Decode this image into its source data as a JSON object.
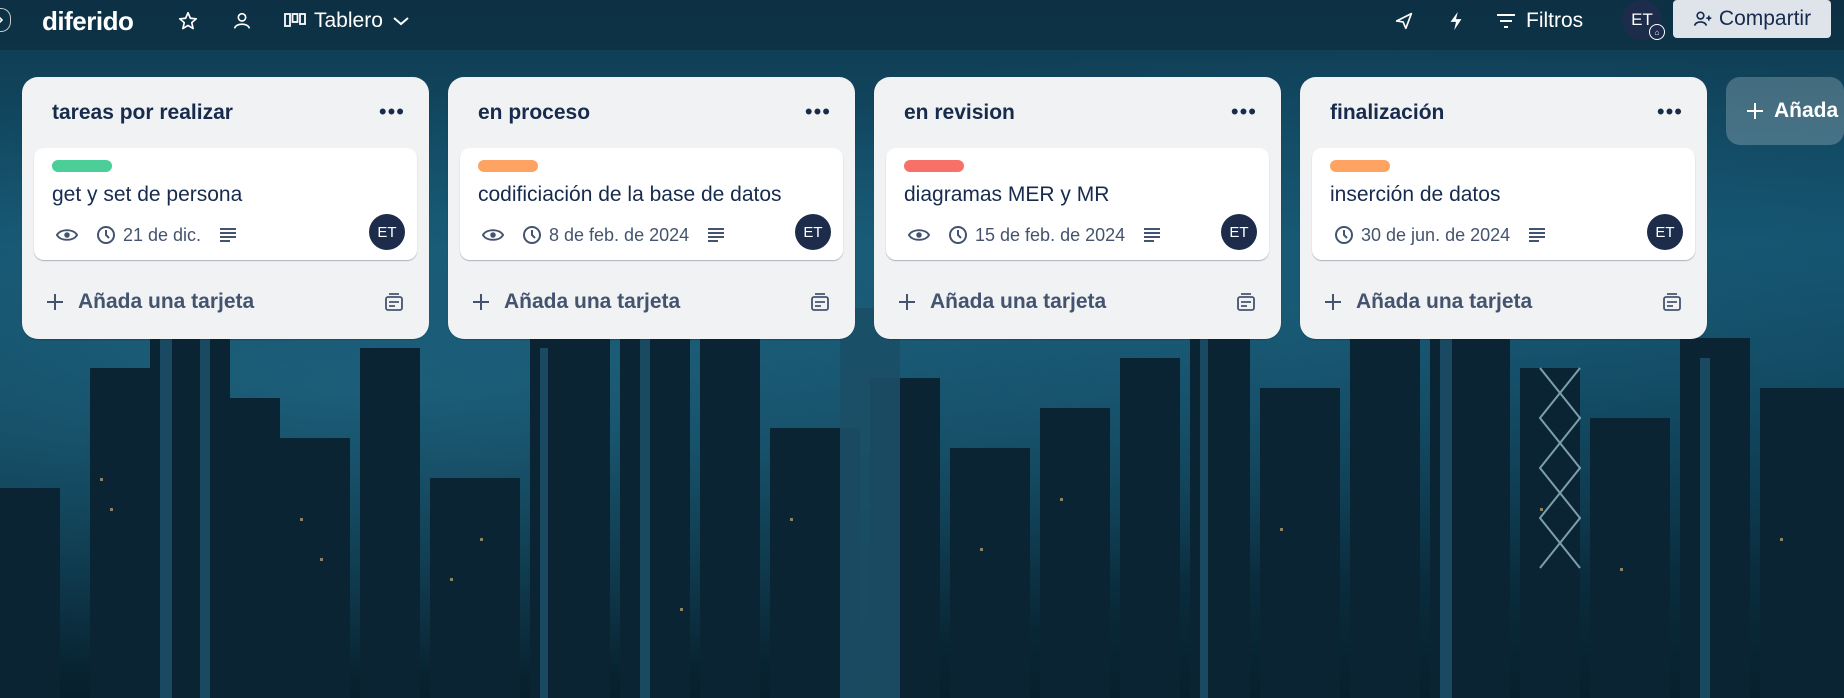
{
  "board": {
    "name": "diferido",
    "view_label": "Tablero",
    "filters_label": "Filtros",
    "user_initials": "ET",
    "share_label": "Compartir",
    "add_list_label": "Añada"
  },
  "lists": [
    {
      "title": "tareas por realizar",
      "card": {
        "title": "get y set de persona",
        "label_color": "#4bce97",
        "date": "21 de dic.",
        "watching": true,
        "member": "ET"
      },
      "add_card_label": "Añada una tarjeta"
    },
    {
      "title": "en proceso",
      "card": {
        "title": "codificiación de la base de datos",
        "label_color": "#fea362",
        "date": "8 de feb. de 2024",
        "watching": true,
        "member": "ET"
      },
      "add_card_label": "Añada una tarjeta"
    },
    {
      "title": "en revision",
      "card": {
        "title": "diagramas MER y MR",
        "label_color": "#f87168",
        "date": "15 de feb. de 2024",
        "watching": true,
        "member": "ET"
      },
      "add_card_label": "Añada una tarjeta"
    },
    {
      "title": "finalización",
      "card": {
        "title": "inserción de datos",
        "label_color": "#fea362",
        "date": "30 de jun. de 2024",
        "watching": false,
        "member": "ET"
      },
      "add_card_label": "Añada una tarjeta"
    }
  ],
  "icons": [
    "chevron-right-icon",
    "star-icon",
    "workspace-visibility-icon",
    "board-view-icon",
    "chevron-down-icon",
    "power-ups-icon",
    "automation-icon",
    "filter-icon",
    "share-user-icon",
    "eye-icon",
    "clock-icon",
    "description-icon",
    "plus-icon",
    "template-icon",
    "more-icon"
  ]
}
